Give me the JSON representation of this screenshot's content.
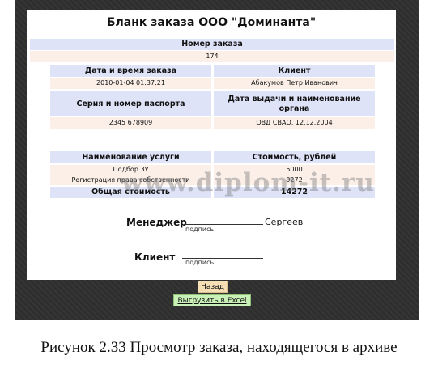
{
  "form": {
    "title": "Бланк заказа ООО \"Доминанта\"",
    "order_number_header": "Номер заказа",
    "order_number": "174",
    "datetime_header": "Дата и время заказа",
    "client_header": "Клиент",
    "datetime_value": "2010-01-04 01:37:21",
    "client_value": "Абакумов Петр Иванович",
    "passport_header": "Серия и номер паспорта",
    "issue_header": "Дата выдачи и наименование органа",
    "passport_value": "2345 678909",
    "issue_value": "ОВД СВАО, 12.12.2004",
    "service_header": "Наименование услуги",
    "cost_header": "Стоимость, рублей",
    "services": [
      {
        "name": "Подбор ЗУ",
        "cost": "5000"
      },
      {
        "name": "Регистрация права собственности",
        "cost": "9272"
      }
    ],
    "total_label": "Общая стоимость",
    "total_value": "14272",
    "manager_label": "Менеджер",
    "manager_signature_hint": "подпись",
    "manager_name": "Сергеев",
    "client_label": "Клиент",
    "client_signature_hint": "подпись"
  },
  "buttons": {
    "back": "Назад",
    "export_excel": "Выгрузить в Excel"
  },
  "watermark": "www.diplom-it.ru",
  "caption": "Рисунок 2.33 Просмотр заказа, находящегося в архиве",
  "colors": {
    "header_bg": "#dfe3f8",
    "value_bg": "#fbefe8",
    "back_button_bg": "#f6dfb5",
    "excel_button_bg": "#c9f0b7",
    "frame_bg": "#2e2e2e"
  }
}
